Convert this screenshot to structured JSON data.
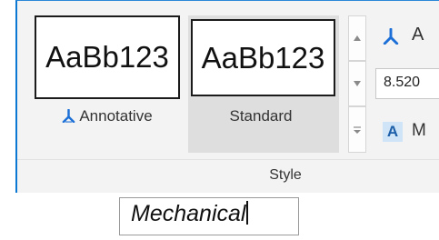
{
  "style_panel": {
    "tiles": [
      {
        "preview": "AaBb123",
        "label": "Annotative",
        "icon": "annotative-scale-icon",
        "selected": false
      },
      {
        "preview": "AaBb123",
        "label": "Standard",
        "icon": "",
        "selected": true
      }
    ],
    "scroll": {
      "up_icon": "triangle-up-icon",
      "down_icon": "triangle-down-icon",
      "more_icon": "gallery-more-icon"
    },
    "right_column": {
      "text_1": "A",
      "height_value": "8.520",
      "text_2": "M"
    },
    "group_label": "Style"
  },
  "edit_box": {
    "value": "Mechanical"
  },
  "colors": {
    "accent_blue": "#0b78d4",
    "icon_blue": "#1c6fd6",
    "selected_tile": "#dedede",
    "panel_bg": "#f3f3f3"
  }
}
